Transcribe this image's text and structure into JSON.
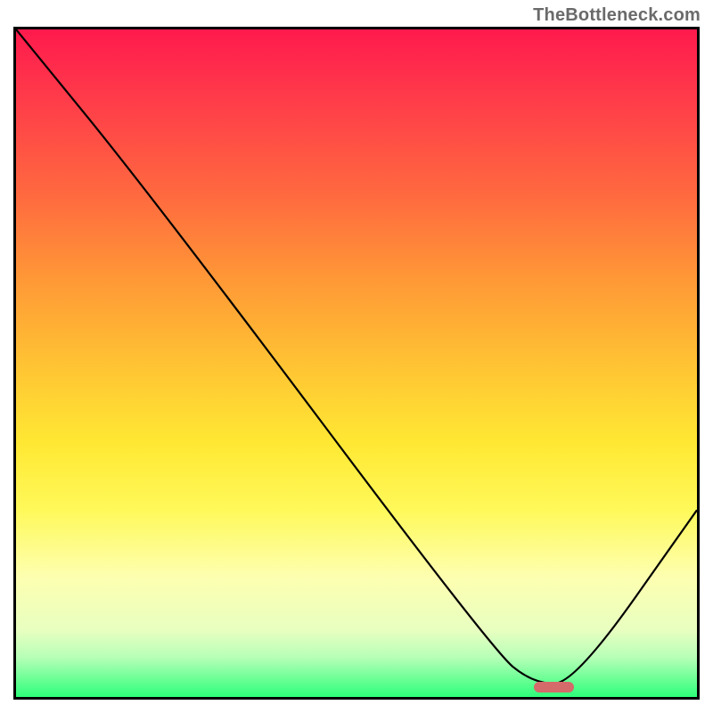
{
  "watermark": "TheBottleneck.com",
  "chart_data": {
    "type": "line",
    "title": "",
    "xlabel": "",
    "ylabel": "",
    "xlim": [
      0,
      100
    ],
    "ylim": [
      0,
      100
    ],
    "grid": false,
    "legend": false,
    "series": [
      {
        "name": "curve",
        "x": [
          0,
          20,
          70,
          76,
          82,
          100
        ],
        "y": [
          100,
          75,
          7,
          2,
          2,
          28
        ]
      }
    ],
    "marker": {
      "x_start": 76,
      "x_end": 82,
      "y": 1.5,
      "color": "#d46a6a"
    },
    "background_gradient": {
      "top": "#ff1a4d",
      "mid": "#ffe833",
      "bottom": "#2dff7a"
    }
  }
}
